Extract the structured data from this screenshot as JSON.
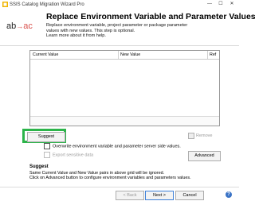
{
  "window": {
    "title": "SSIS Catalog Migration Wizard Pro",
    "controls": {
      "minimize": "—",
      "maximize": "☐",
      "close": "✕"
    }
  },
  "logo": {
    "left": "ab",
    "arrow": "→",
    "right": "ac"
  },
  "header": {
    "title": "Replace Environment Variable and Parameter Values",
    "description_lines": [
      "Replace environment variable, project parameter or package parameter",
      "values with new values. This step is optional.",
      "Learn more about it from help."
    ]
  },
  "grid": {
    "columns": [
      "Current Value",
      "New Value",
      "Ref"
    ]
  },
  "actions": {
    "suggest_label": "Suggest",
    "remove_label": "Remove",
    "advanced_label": "Advanced"
  },
  "options": {
    "overwrite_label": "Overwrite environment variable and parameter server side values.",
    "export_label": "Export sensitive data"
  },
  "suggest_info": {
    "title": "Suggest",
    "lines": [
      "Same Current Value and New Value pairs in above grid will be ignored.",
      "Click on Advanced button to configure environment variables and parameters values."
    ]
  },
  "footer": {
    "back_label": "< Back",
    "next_label": "Next >",
    "cancel_label": "Cancel",
    "help_symbol": "?"
  },
  "colors": {
    "highlight": "#2cb44a",
    "accent_red": "#d9534f",
    "help_blue": "#3a73c6"
  }
}
